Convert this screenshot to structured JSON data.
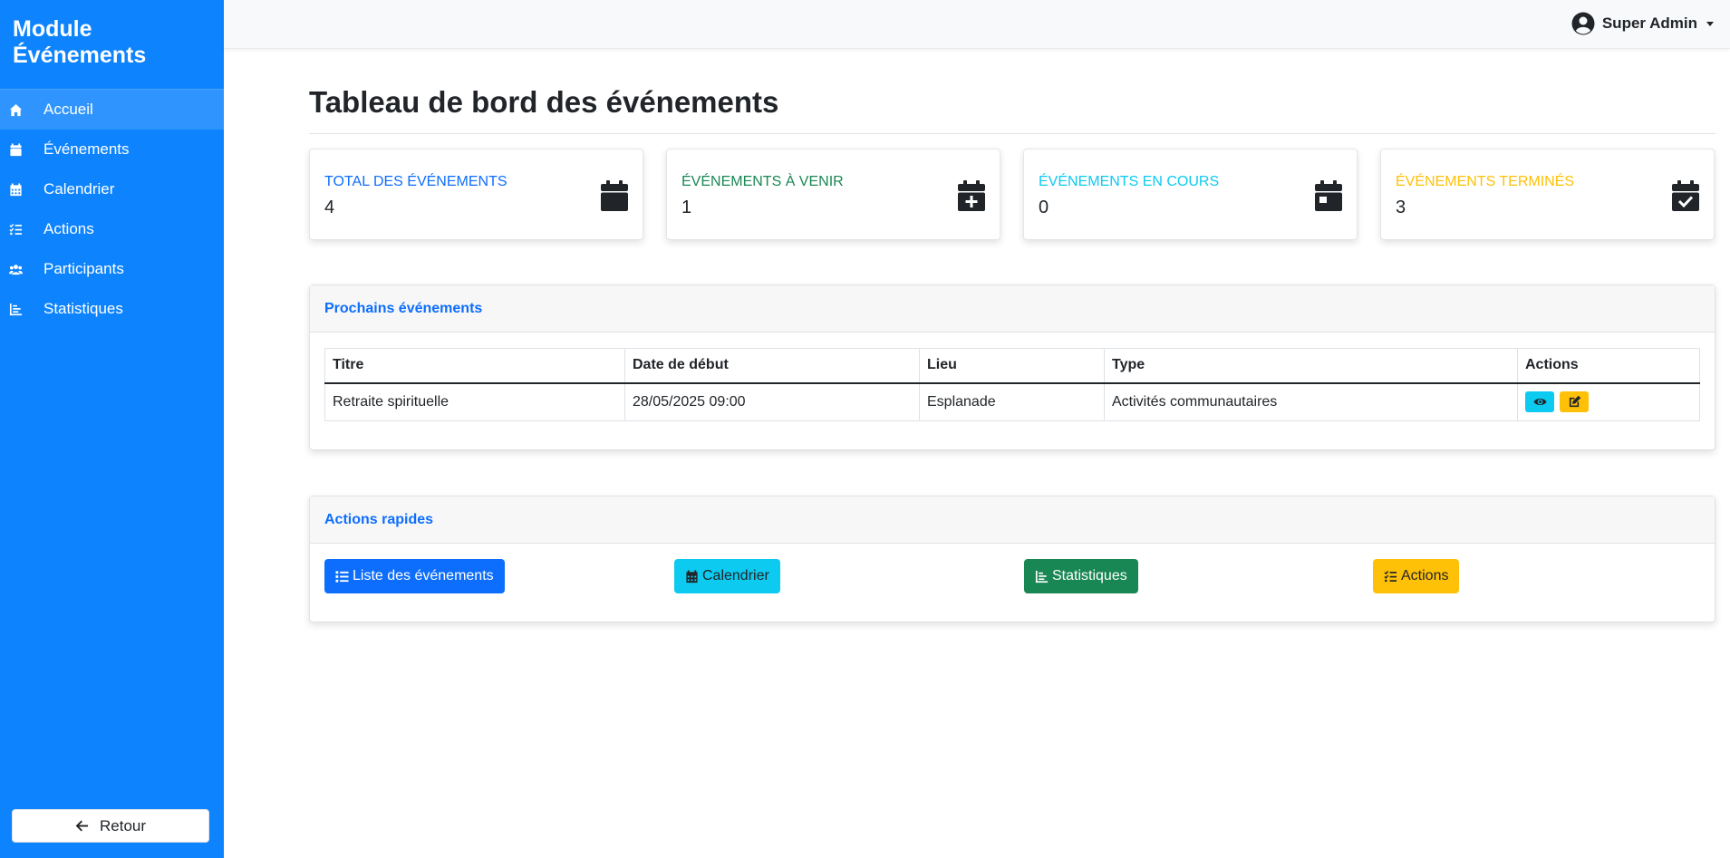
{
  "sidebar": {
    "brand": "Module Événements",
    "items": [
      {
        "label": "Accueil",
        "icon": "home-icon"
      },
      {
        "label": "Événements",
        "icon": "calendar-icon"
      },
      {
        "label": "Calendrier",
        "icon": "calendar-grid-icon"
      },
      {
        "label": "Actions",
        "icon": "list-check-icon"
      },
      {
        "label": "Participants",
        "icon": "users-icon"
      },
      {
        "label": "Statistiques",
        "icon": "chart-bar-icon"
      }
    ],
    "back_label": "Retour"
  },
  "topbar": {
    "user_name": "Super Admin"
  },
  "main": {
    "title": "Tableau de bord des événements",
    "stats": [
      {
        "label": "Total des événements",
        "value": "4",
        "color": "#0d6efd",
        "icon": "calendar-icon"
      },
      {
        "label": "Événements à venir",
        "value": "1",
        "color": "#198754",
        "icon": "calendar-plus-icon"
      },
      {
        "label": "Événements en cours",
        "value": "0",
        "color": "#0dcaf0",
        "icon": "calendar-day-icon"
      },
      {
        "label": "Événements terminés",
        "value": "3",
        "color": "#ffc107",
        "icon": "calendar-check-icon"
      }
    ],
    "upcoming": {
      "title": "Prochains événements",
      "columns": [
        "Titre",
        "Date de début",
        "Lieu",
        "Type",
        "Actions"
      ],
      "rows": [
        {
          "titre": "Retraite spirituelle",
          "date": "28/05/2025 09:00",
          "lieu": "Esplanade",
          "type": "Activités communautaires"
        }
      ]
    },
    "quick_actions": {
      "title": "Actions rapides",
      "buttons": [
        {
          "label": "Liste des événements",
          "color": "#0d6efd",
          "icon": "list-icon"
        },
        {
          "label": "Calendrier",
          "color": "#0dcaf0",
          "icon": "calendar-grid-icon"
        },
        {
          "label": "Statistiques",
          "color": "#198754",
          "icon": "chart-bar-icon"
        },
        {
          "label": "Actions",
          "color": "#ffc107",
          "icon": "list-check-icon"
        }
      ]
    }
  }
}
